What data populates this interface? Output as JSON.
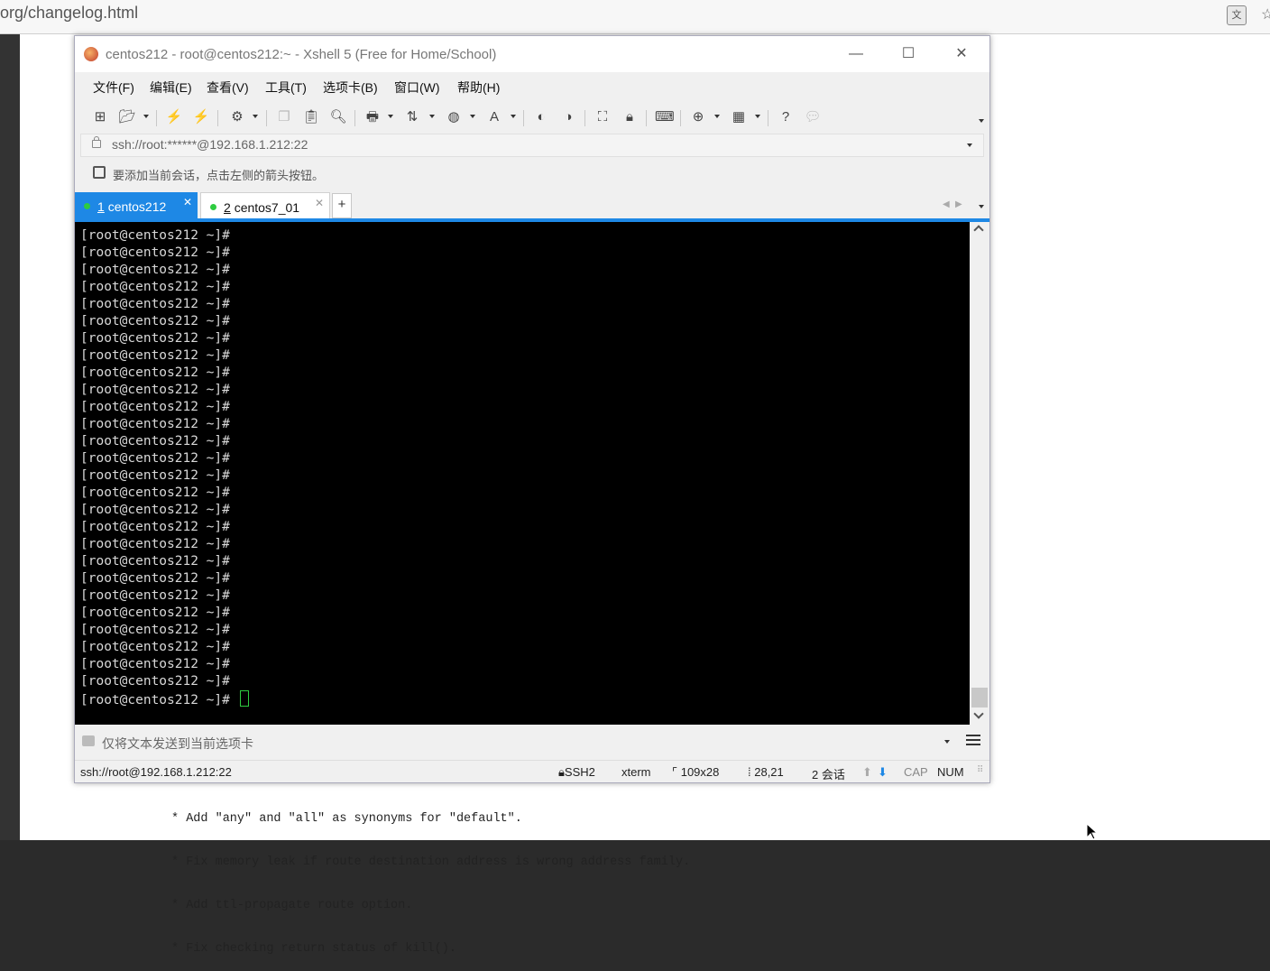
{
  "browser": {
    "url": "org/changelog.html"
  },
  "window": {
    "title": "centos212 - root@centos212:~ - Xshell 5 (Free for Home/School)"
  },
  "menu": {
    "file": "文件(F)",
    "edit": "编辑(E)",
    "view": "查看(V)",
    "tools": "工具(T)",
    "tab": "选项卡(B)",
    "window": "窗口(W)",
    "help": "帮助(H)"
  },
  "address": {
    "text": "ssh://root:******@192.168.1.212:22"
  },
  "hint": {
    "text": "要添加当前会话，点击左侧的箭头按钮。"
  },
  "tabs": [
    {
      "num": "1",
      "name": "centos212"
    },
    {
      "num": "2",
      "name": "centos7_01"
    }
  ],
  "tab_add": "+",
  "terminal": {
    "lines": [
      "[root@centos212 ~]#",
      "[root@centos212 ~]#",
      "[root@centos212 ~]#",
      "[root@centos212 ~]#",
      "[root@centos212 ~]#",
      "[root@centos212 ~]#",
      "[root@centos212 ~]#",
      "[root@centos212 ~]#",
      "[root@centos212 ~]#",
      "[root@centos212 ~]#",
      "[root@centos212 ~]#",
      "[root@centos212 ~]#",
      "[root@centos212 ~]#",
      "[root@centos212 ~]#",
      "[root@centos212 ~]#",
      "[root@centos212 ~]#",
      "[root@centos212 ~]#",
      "[root@centos212 ~]#",
      "[root@centos212 ~]#",
      "[root@centos212 ~]#",
      "[root@centos212 ~]#",
      "[root@centos212 ~]#",
      "[root@centos212 ~]#",
      "[root@centos212 ~]#",
      "[root@centos212 ~]#",
      "[root@centos212 ~]#",
      "[root@centos212 ~]#",
      "[root@centos212 ~]# "
    ]
  },
  "send": {
    "text": "仅将文本发送到当前选项卡"
  },
  "status": {
    "connection": "ssh://root@192.168.1.212:22",
    "protocol": "SSH2",
    "term": "xterm",
    "size": "109x28",
    "cursor": "28,21",
    "sessions": "2 会话",
    "cap": "CAP",
    "num": "NUM"
  },
  "document": {
    "lines": [
      "* Add \"any\" and \"all\" as synonyms for \"default\".",
      "* Fix memory leak if route destination address is wrong address family.",
      "* Add ttl-propagate route option.",
      "* Fix checking return status of kill()."
    ]
  },
  "colors": {
    "accent": "#1e88e5",
    "terminal_bg": "#000000",
    "terminal_fg": "#d8d8d8",
    "cursor": "#2ecc40"
  }
}
